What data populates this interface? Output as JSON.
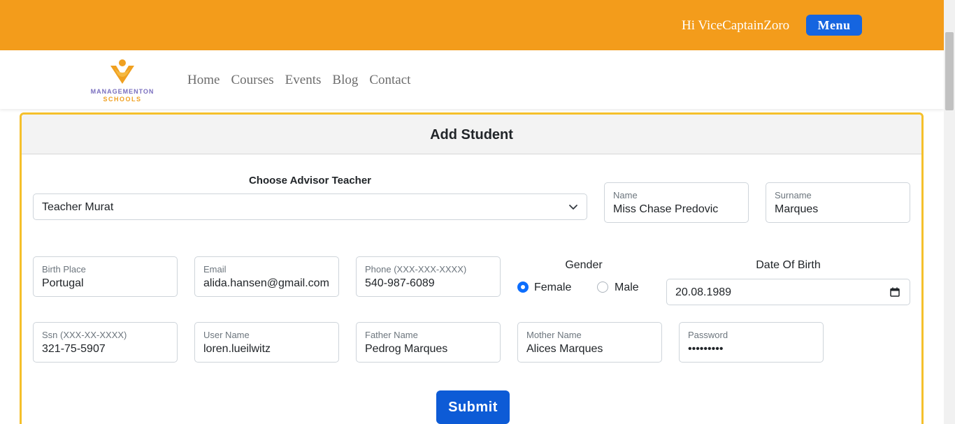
{
  "header": {
    "greeting": "Hi ViceCaptainZoro",
    "menu_label": "Menu"
  },
  "brand": {
    "line1": "MANAGEMENTON",
    "line2": "SCHOOLS"
  },
  "nav": {
    "items": [
      "Home",
      "Courses",
      "Events",
      "Blog",
      "Contact"
    ]
  },
  "form": {
    "title": "Add Student",
    "advisor_label": "Choose Advisor Teacher",
    "advisor_value": "Teacher Murat",
    "name": {
      "label": "Name",
      "value": "Miss Chase Predovic"
    },
    "surname": {
      "label": "Surname",
      "value": "Marques"
    },
    "birth_place": {
      "label": "Birth Place",
      "value": "Portugal"
    },
    "email": {
      "label": "Email",
      "value": "alida.hansen@gmail.com"
    },
    "phone": {
      "label": "Phone (XXX-XXX-XXXX)",
      "value": "540-987-6089"
    },
    "gender": {
      "label": "Gender",
      "female": "Female",
      "male": "Male",
      "selected": "Female"
    },
    "dob": {
      "label": "Date Of Birth",
      "value": "20.08.1989"
    },
    "ssn": {
      "label": "Ssn (XXX-XX-XXXX)",
      "value": "321-75-5907"
    },
    "username": {
      "label": "User Name",
      "value": "loren.lueilwitz"
    },
    "father": {
      "label": "Father Name",
      "value": "Pedrog Marques"
    },
    "mother": {
      "label": "Mother Name",
      "value": "Alices Marques"
    },
    "password": {
      "label": "Password",
      "value": "•••••••••"
    },
    "submit_label": "Submit"
  },
  "colors": {
    "topbar": "#f39c1b",
    "primary": "#0d6efd",
    "card_border": "#f5c02b"
  }
}
